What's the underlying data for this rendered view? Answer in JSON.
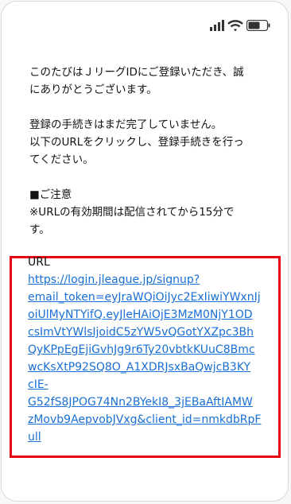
{
  "status_bar": {
    "signal_icon": "cellular-signal-icon",
    "wifi_icon": "wifi-icon",
    "battery_icon": "battery-icon"
  },
  "message": {
    "intro": "このたびはＪリーグIDにご登録いただき、誠\nにありがとうございます。",
    "incomplete": "登録の手続きはまだ完了していません。\n以下のURLをクリックし、登録手続きを行っ\nてください。",
    "notice_heading": "■ご注意",
    "notice_body": "※URLの有効期間は配信されてから15分で\nす。"
  },
  "url_section": {
    "label": "URL",
    "link": "https://login.jleague.jp/signup?\nemail_token=eyJraWQiOiJyc2ExIiwiYWxnIj\noiUlMyNTYifQ.eyJleHAiOjE3MzM0NjY1OD\ncsImVtYWlsIjoidC5zYW5vQGotYXZpc3Bh\nQyKPpEgEjiGvhJg9r6Ty20vbtkKUuC8Bmc\nwcKsXtP92SQ8O_A1XDRJsxBaQwjcB3KY\ncIE-\nG52fS8JPOG74Nn2BYekI8_3jEBaAftIAMW\nzMovb9AepvobJVxg&client_id=nmkdbRpF\null",
    "highlight_color": "#e60012",
    "link_color": "#1a6fd4"
  }
}
